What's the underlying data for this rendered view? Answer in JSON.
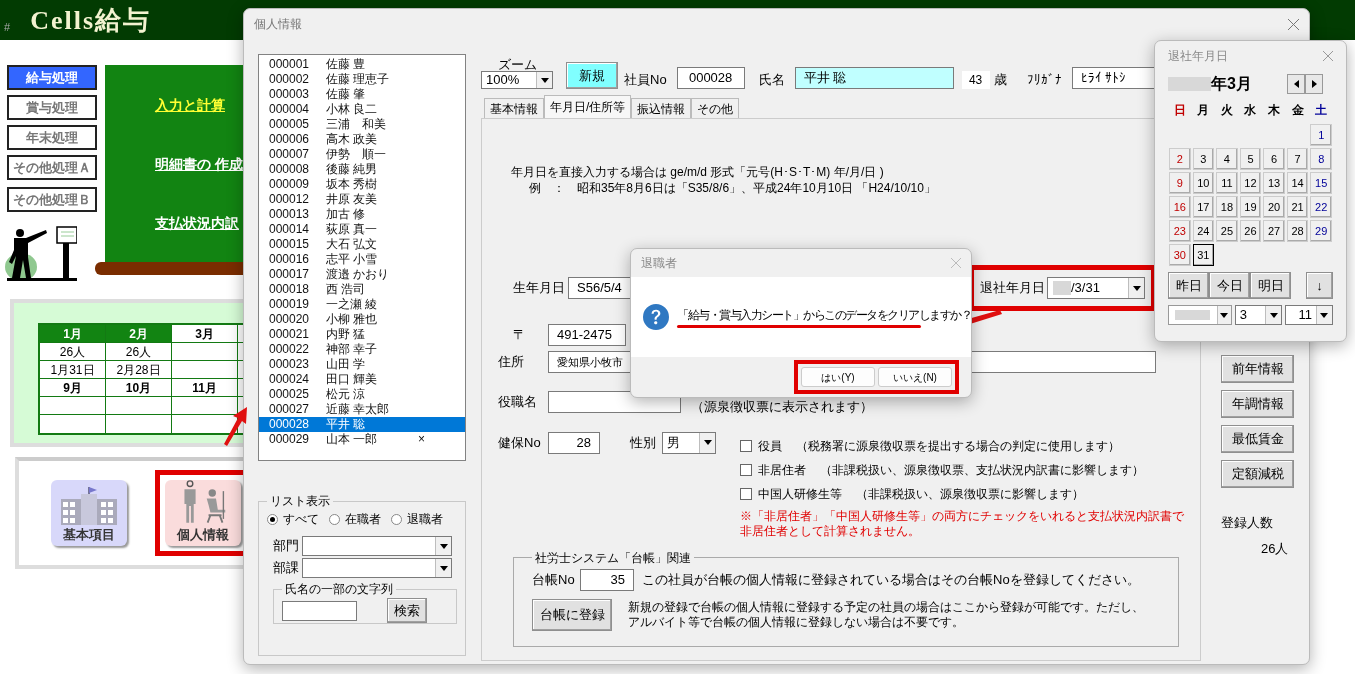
{
  "app": {
    "mark": "#",
    "title": "Cells給与",
    "menu": [
      {
        "label": "給与処理",
        "selected": true
      },
      {
        "label": "賞与処理",
        "selected": false
      },
      {
        "label": "年末処理",
        "selected": false
      },
      {
        "label": "その他処理Ａ",
        "selected": false
      },
      {
        "label": "その他処理Ｂ",
        "selected": false
      }
    ],
    "board_links": [
      {
        "label": "入力と計算",
        "color": "#ffff33"
      },
      {
        "label": "明細書の 作成",
        "color": "#ffffff"
      },
      {
        "label": "支払状況内訳",
        "color": "#ffffff"
      }
    ],
    "schedule": [
      {
        "kind": "month",
        "cells": [
          {
            "text": "1月",
            "current": false
          },
          {
            "text": "2月",
            "current": false
          },
          {
            "text": "3月",
            "current": true
          }
        ]
      },
      {
        "kind": "data",
        "cells": [
          "26人",
          "26人"
        ]
      },
      {
        "kind": "data",
        "cells": [
          "1月31日",
          "2月28日"
        ]
      },
      {
        "kind": "month",
        "cells": [
          {
            "text": "9月",
            "current": true
          },
          {
            "text": "10月",
            "current": true
          },
          {
            "text": "11月",
            "current": true
          }
        ]
      },
      {
        "kind": "data"
      },
      {
        "kind": "data"
      }
    ],
    "shortcuts": [
      {
        "label": "基本項目",
        "kind": "building",
        "highlighted": false
      },
      {
        "label": "個人情報",
        "kind": "people",
        "highlighted": true
      }
    ]
  },
  "window": {
    "title": "個人情報",
    "employees": [
      {
        "no": "000001",
        "name": "佐藤 豊",
        "selected": false
      },
      {
        "no": "000002",
        "name": "佐藤 理恵子",
        "selected": false
      },
      {
        "no": "000003",
        "name": "佐藤 肇",
        "selected": false
      },
      {
        "no": "000004",
        "name": "小林 良二",
        "selected": false
      },
      {
        "no": "000005",
        "name": "三浦　和美",
        "selected": false
      },
      {
        "no": "000006",
        "name": "高木 政美",
        "selected": false
      },
      {
        "no": "000007",
        "name": "伊勢　順一",
        "selected": false
      },
      {
        "no": "000008",
        "name": "後藤 純男",
        "selected": false
      },
      {
        "no": "000009",
        "name": "坂本 秀樹",
        "selected": false
      },
      {
        "no": "000012",
        "name": "井原 友美",
        "selected": false
      },
      {
        "no": "000013",
        "name": "加古 修",
        "selected": false
      },
      {
        "no": "000014",
        "name": "荻原 真一",
        "selected": false
      },
      {
        "no": "000015",
        "name": "大石 弘文",
        "selected": false
      },
      {
        "no": "000016",
        "name": "志平 小雪",
        "selected": false
      },
      {
        "no": "000017",
        "name": "渡邉 かおり",
        "selected": false
      },
      {
        "no": "000018",
        "name": "西 浩司",
        "selected": false
      },
      {
        "no": "000019",
        "name": "一之瀬 綾",
        "selected": false
      },
      {
        "no": "000020",
        "name": "小柳 雅也",
        "selected": false
      },
      {
        "no": "000021",
        "name": "内野 猛",
        "selected": false
      },
      {
        "no": "000022",
        "name": "神部 幸子",
        "selected": false
      },
      {
        "no": "000023",
        "name": "山田 学",
        "selected": false
      },
      {
        "no": "000024",
        "name": "田口 輝美",
        "selected": false
      },
      {
        "no": "000025",
        "name": "松元 涼",
        "selected": false
      },
      {
        "no": "000027",
        "name": "近藤 幸太郎",
        "selected": false
      },
      {
        "no": "000028",
        "name": "平井 聡",
        "selected": true
      },
      {
        "no": "000029",
        "name": "山本 一郎",
        "selected": false,
        "mark": "×"
      }
    ],
    "list_filter": {
      "title": "リスト表示",
      "options": [
        {
          "label": "すべて",
          "selected": true
        },
        {
          "label": "在職者",
          "selected": false
        },
        {
          "label": "退職者",
          "selected": false
        }
      ],
      "department_label": "部門",
      "section_label": "部課",
      "search_title": "氏名の一部の文字列",
      "search_button": "検索"
    },
    "toolbar": {
      "zoom_label": "ズーム",
      "zoom": "100%",
      "new_button": "新規",
      "employee_no_label": "社員No",
      "employee_no": "000028",
      "name_label": "氏名",
      "name": "平井 聡",
      "age": "43",
      "age_unit": "歳",
      "kana_label": "ﾌﾘｶﾞﾅ",
      "kana": "ﾋﾗｲ ｻﾄｼ"
    },
    "tabs": [
      {
        "label": "基本情報",
        "selected": false
      },
      {
        "label": "年月日/住所等",
        "selected": true
      },
      {
        "label": "振込情報",
        "selected": false
      },
      {
        "label": "その他",
        "selected": false
      }
    ],
    "form": {
      "instructions": [
        "年月日を直接入力する場合は ge/m/d  形式「元号(H･S･T･M)  年/月/日 )",
        "例　：　昭和35年8月6日は「S35/8/6」、平成24年10月10日 「H24/10/10」"
      ],
      "birth_label": "生年月日",
      "birth": "S56/5/4",
      "retire_label": "退社年月日",
      "retire": "/3/31",
      "retire_highlighted": true,
      "zip_label": "〒",
      "zip": "491-2475",
      "address_label": "住所",
      "address": "愛知県小牧市",
      "title_label": "役職名",
      "title_note": "（源泉徴収票に表示されます）",
      "insurance_label": "健保No",
      "insurance": "28",
      "gender_label": "性別",
      "gender": "男",
      "flags": [
        {
          "label": "役員",
          "note": "（税務署に源泉徴収票を提出する場合の判定に使用します）",
          "checked": false
        },
        {
          "label": "非居住者",
          "note": "（非課税扱い、源泉徴収票、支払状況内訳書に影響します）",
          "checked": false
        },
        {
          "label": "中国人研修生等",
          "note": "（非課税扱い、源泉徴収票に影響します）",
          "checked": false
        }
      ],
      "warning": "※「非居住者」「中国人研修生等」の両方にチェックをいれると支払状況内訳書で非居住者として計算されません。",
      "ledger": {
        "title": "社労士システム「台帳」関連",
        "no_label": "台帳No",
        "no": "35",
        "no_help": "この社員が台帳の個人情報に登録されている場合はその台帳Noを登録してください。",
        "register_button": "台帳に登録",
        "register_help": [
          "新規の登録で台帳の個人情報に登録する予定の社員の場合はここから登録が可能です。ただし、",
          "アルバイト等で台帳の個人情報に登録しない場合は不要です。"
        ]
      }
    },
    "side_buttons": [
      "前年情報",
      "年調情報",
      "最低賃金",
      "定額減税"
    ],
    "count_label": "登録人数",
    "count": "26人"
  },
  "dialog": {
    "title": "退職者",
    "message": "「給与・賞与入力シート」からこのデータをクリアしますか？",
    "buttons": [
      "はい(Y)",
      "いいえ(N)"
    ],
    "highlighted": true
  },
  "calendar": {
    "title": "退社年月日",
    "year_month": "年3月",
    "weekdays": [
      "日",
      "月",
      "火",
      "水",
      "木",
      "金",
      "土"
    ],
    "weeks": [
      [
        {
          "d": "1",
          "selected": false
        }
      ],
      [
        {
          "d": "2",
          "selected": false
        },
        {
          "d": "3",
          "selected": false
        },
        {
          "d": "4",
          "selected": false
        },
        {
          "d": "5",
          "selected": false
        },
        {
          "d": "6",
          "selected": false
        },
        {
          "d": "7",
          "selected": false
        },
        {
          "d": "8",
          "selected": false
        }
      ],
      [
        {
          "d": "9",
          "selected": false
        },
        {
          "d": "10",
          "selected": false
        },
        {
          "d": "11",
          "selected": false
        },
        {
          "d": "12",
          "selected": false
        },
        {
          "d": "13",
          "selected": false
        },
        {
          "d": "14",
          "selected": false
        },
        {
          "d": "15",
          "selected": false
        }
      ],
      [
        {
          "d": "16",
          "selected": false
        },
        {
          "d": "17",
          "selected": false
        },
        {
          "d": "18",
          "selected": false
        },
        {
          "d": "19",
          "selected": false
        },
        {
          "d": "20",
          "selected": false
        },
        {
          "d": "21",
          "selected": false
        },
        {
          "d": "22",
          "selected": false
        }
      ],
      [
        {
          "d": "23",
          "selected": false
        },
        {
          "d": "24",
          "selected": false
        },
        {
          "d": "25",
          "selected": false
        },
        {
          "d": "26",
          "selected": false
        },
        {
          "d": "27",
          "selected": false
        },
        {
          "d": "28",
          "selected": false
        },
        {
          "d": "29",
          "selected": false
        }
      ],
      [
        {
          "d": "30",
          "selected": false
        },
        {
          "d": "31",
          "selected": true
        }
      ]
    ],
    "quick_buttons": [
      "昨日",
      "今日",
      "明日"
    ],
    "down_button": "↓",
    "month": "3",
    "day": "11"
  }
}
